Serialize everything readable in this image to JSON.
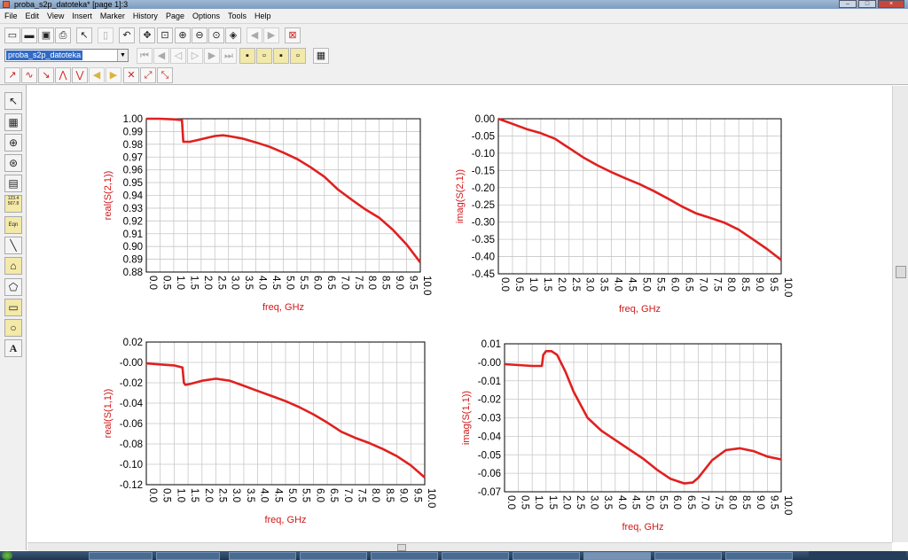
{
  "window": {
    "title": "proba_s2p_datoteka* [page 1]:3"
  },
  "menu": [
    "File",
    "Edit",
    "View",
    "Insert",
    "Marker",
    "History",
    "Page",
    "Options",
    "Tools",
    "Help"
  ],
  "toolbar": {
    "design_select_value": "proba_s2p_datoteka",
    "row1_icons": [
      "new-file-icon",
      "open-folder-icon",
      "save-icon",
      "print-icon",
      "pointer-icon",
      "delete-icon",
      "undo-icon",
      "move-icon",
      "zoom-box-icon",
      "zoom-in-icon",
      "zoom-out-icon",
      "zoom-fit-icon",
      "view-all-icon",
      "nav-back-icon",
      "nav-forward-icon",
      "stop-icon"
    ],
    "row2_icons": [
      "first-page-icon",
      "prev-block-icon",
      "prev-page-icon",
      "next-page-icon",
      "next-block-icon",
      "last-page-icon",
      "marker-a-icon",
      "marker-b-icon",
      "marker-c-icon",
      "marker-d-icon",
      "layout-icon"
    ],
    "row3_icons": [
      "marker-new-icon",
      "marker-trace-icon",
      "marker-delta-icon",
      "marker-max-icon",
      "marker-min-icon",
      "marker-prev-icon",
      "marker-next-icon",
      "line-marker-icon",
      "slope-marker-icon"
    ]
  },
  "palette": {
    "icons": [
      "select-arrow-icon",
      "rectangular-plot-icon",
      "polar-plot-icon",
      "smith-chart-icon",
      "list-table-icon",
      "stacked-plot-icon",
      "equation-icon",
      "line-tool-icon",
      "polyline-icon",
      "polygon-icon",
      "rectangle-icon",
      "circle-icon",
      "text-icon"
    ],
    "list_label": "123.4\n567.8",
    "eqn_label": "Eqn",
    "text_label": "A"
  },
  "chart_data": [
    {
      "type": "line",
      "xlabel": "freq, GHz",
      "ylabel": "real(S(2,1))",
      "xlim": [
        0.0,
        10.0
      ],
      "ylim": [
        0.88,
        1.0
      ],
      "x_ticks": [
        "0.0",
        "0.5",
        "1.0",
        "1.5",
        "2.0",
        "2.5",
        "3.0",
        "3.5",
        "4.0",
        "4.5",
        "5.0",
        "5.5",
        "6.0",
        "6.5",
        "7.0",
        "7.5",
        "8.0",
        "8.5",
        "9.0",
        "9.5",
        "10.0"
      ],
      "y_ticks": [
        "1.00",
        "0.99",
        "0.98",
        "0.97",
        "0.96",
        "0.95",
        "0.94",
        "0.93",
        "0.92",
        "0.91",
        "0.90",
        "0.89",
        "0.88"
      ],
      "color": "#e02020",
      "grid": true,
      "series": [
        {
          "x": [
            0.0,
            0.5,
            1.0,
            1.3,
            1.35,
            1.4,
            1.6,
            2.0,
            2.5,
            2.8,
            3.0,
            3.5,
            4.0,
            4.5,
            5.0,
            5.5,
            6.0,
            6.5,
            7.0,
            7.5,
            8.0,
            8.5,
            9.0,
            9.5,
            10.0
          ],
          "y": [
            1.0,
            1.0,
            0.9995,
            0.999,
            0.982,
            0.982,
            0.982,
            0.984,
            0.9865,
            0.987,
            0.9865,
            0.9845,
            0.9815,
            0.978,
            0.9735,
            0.9685,
            0.962,
            0.9545,
            0.9445,
            0.9365,
            0.929,
            0.9225,
            0.913,
            0.9015,
            0.8875
          ]
        }
      ]
    },
    {
      "type": "line",
      "xlabel": "freq, GHz",
      "ylabel": "imag(S(2,1))",
      "xlim": [
        0.0,
        10.0
      ],
      "ylim": [
        -0.45,
        0.0
      ],
      "x_ticks": [
        "0.0",
        "0.5",
        "1.0",
        "1.5",
        "2.0",
        "2.5",
        "3.0",
        "3.5",
        "4.0",
        "4.5",
        "5.0",
        "5.5",
        "6.0",
        "6.5",
        "7.0",
        "7.5",
        "8.0",
        "8.5",
        "9.0",
        "9.5",
        "10.0"
      ],
      "y_ticks": [
        "0.00",
        "-0.05",
        "-0.10",
        "-0.15",
        "-0.20",
        "-0.25",
        "-0.30",
        "-0.35",
        "-0.40",
        "-0.45"
      ],
      "color": "#e02020",
      "grid": true,
      "series": [
        {
          "x": [
            0.0,
            0.5,
            1.0,
            1.5,
            2.0,
            2.5,
            3.0,
            3.5,
            4.0,
            4.5,
            5.0,
            5.5,
            6.0,
            6.5,
            7.0,
            7.5,
            8.0,
            8.5,
            9.0,
            9.5,
            10.0
          ],
          "y": [
            0.0,
            -0.015,
            -0.03,
            -0.042,
            -0.058,
            -0.085,
            -0.112,
            -0.135,
            -0.155,
            -0.173,
            -0.19,
            -0.21,
            -0.232,
            -0.255,
            -0.275,
            -0.288,
            -0.302,
            -0.322,
            -0.35,
            -0.378,
            -0.41
          ]
        }
      ]
    },
    {
      "type": "line",
      "xlabel": "freq, GHz",
      "ylabel": "real(S(1,1))",
      "xlim": [
        0.0,
        10.0
      ],
      "ylim": [
        -0.12,
        0.02
      ],
      "x_ticks": [
        "0.0",
        "0.5",
        "1.0",
        "1.5",
        "2.0",
        "2.5",
        "3.0",
        "3.5",
        "4.0",
        "4.5",
        "5.0",
        "5.5",
        "6.0",
        "6.5",
        "7.0",
        "7.5",
        "8.0",
        "8.5",
        "9.0",
        "9.5",
        "10.0"
      ],
      "y_ticks": [
        "0.02",
        "-0.00",
        "-0.02",
        "-0.04",
        "-0.06",
        "-0.08",
        "-0.10",
        "-0.12"
      ],
      "color": "#e02020",
      "grid": true,
      "series": [
        {
          "x": [
            0.0,
            0.5,
            1.0,
            1.3,
            1.35,
            1.4,
            1.6,
            2.0,
            2.5,
            3.0,
            3.5,
            4.0,
            4.5,
            5.0,
            5.5,
            6.0,
            6.5,
            7.0,
            7.5,
            8.0,
            8.5,
            9.0,
            9.5,
            10.0
          ],
          "y": [
            -0.001,
            -0.002,
            -0.003,
            -0.005,
            -0.02,
            -0.022,
            -0.021,
            -0.018,
            -0.016,
            -0.018,
            -0.023,
            -0.028,
            -0.033,
            -0.038,
            -0.044,
            -0.051,
            -0.059,
            -0.068,
            -0.074,
            -0.079,
            -0.085,
            -0.092,
            -0.101,
            -0.113
          ]
        }
      ]
    },
    {
      "type": "line",
      "xlabel": "freq, GHz",
      "ylabel": "imag(S(1,1))",
      "xlim": [
        0.0,
        10.0
      ],
      "ylim": [
        -0.07,
        0.01
      ],
      "x_ticks": [
        "0.0",
        "0.5",
        "1.0",
        "1.5",
        "2.0",
        "2.5",
        "3.0",
        "3.5",
        "4.0",
        "4.5",
        "5.0",
        "5.5",
        "6.0",
        "6.5",
        "7.0",
        "7.5",
        "8.0",
        "8.5",
        "9.0",
        "9.5",
        "10.0"
      ],
      "y_ticks": [
        "0.01",
        "-0.00",
        "-0.01",
        "-0.02",
        "-0.03",
        "-0.04",
        "-0.05",
        "-0.06",
        "-0.07"
      ],
      "color": "#e02020",
      "grid": true,
      "series": [
        {
          "x": [
            0.0,
            0.5,
            1.0,
            1.35,
            1.4,
            1.5,
            1.7,
            1.9,
            2.2,
            2.5,
            3.0,
            3.5,
            4.0,
            4.5,
            5.0,
            5.5,
            6.0,
            6.5,
            6.8,
            7.0,
            7.5,
            8.0,
            8.5,
            9.0,
            9.5,
            10.0
          ],
          "y": [
            -0.001,
            -0.0015,
            -0.002,
            -0.002,
            0.004,
            0.006,
            0.006,
            0.004,
            -0.005,
            -0.016,
            -0.03,
            -0.037,
            -0.042,
            -0.047,
            -0.052,
            -0.058,
            -0.063,
            -0.0655,
            -0.065,
            -0.0625,
            -0.053,
            -0.0475,
            -0.0465,
            -0.048,
            -0.051,
            -0.0525
          ]
        }
      ]
    }
  ]
}
